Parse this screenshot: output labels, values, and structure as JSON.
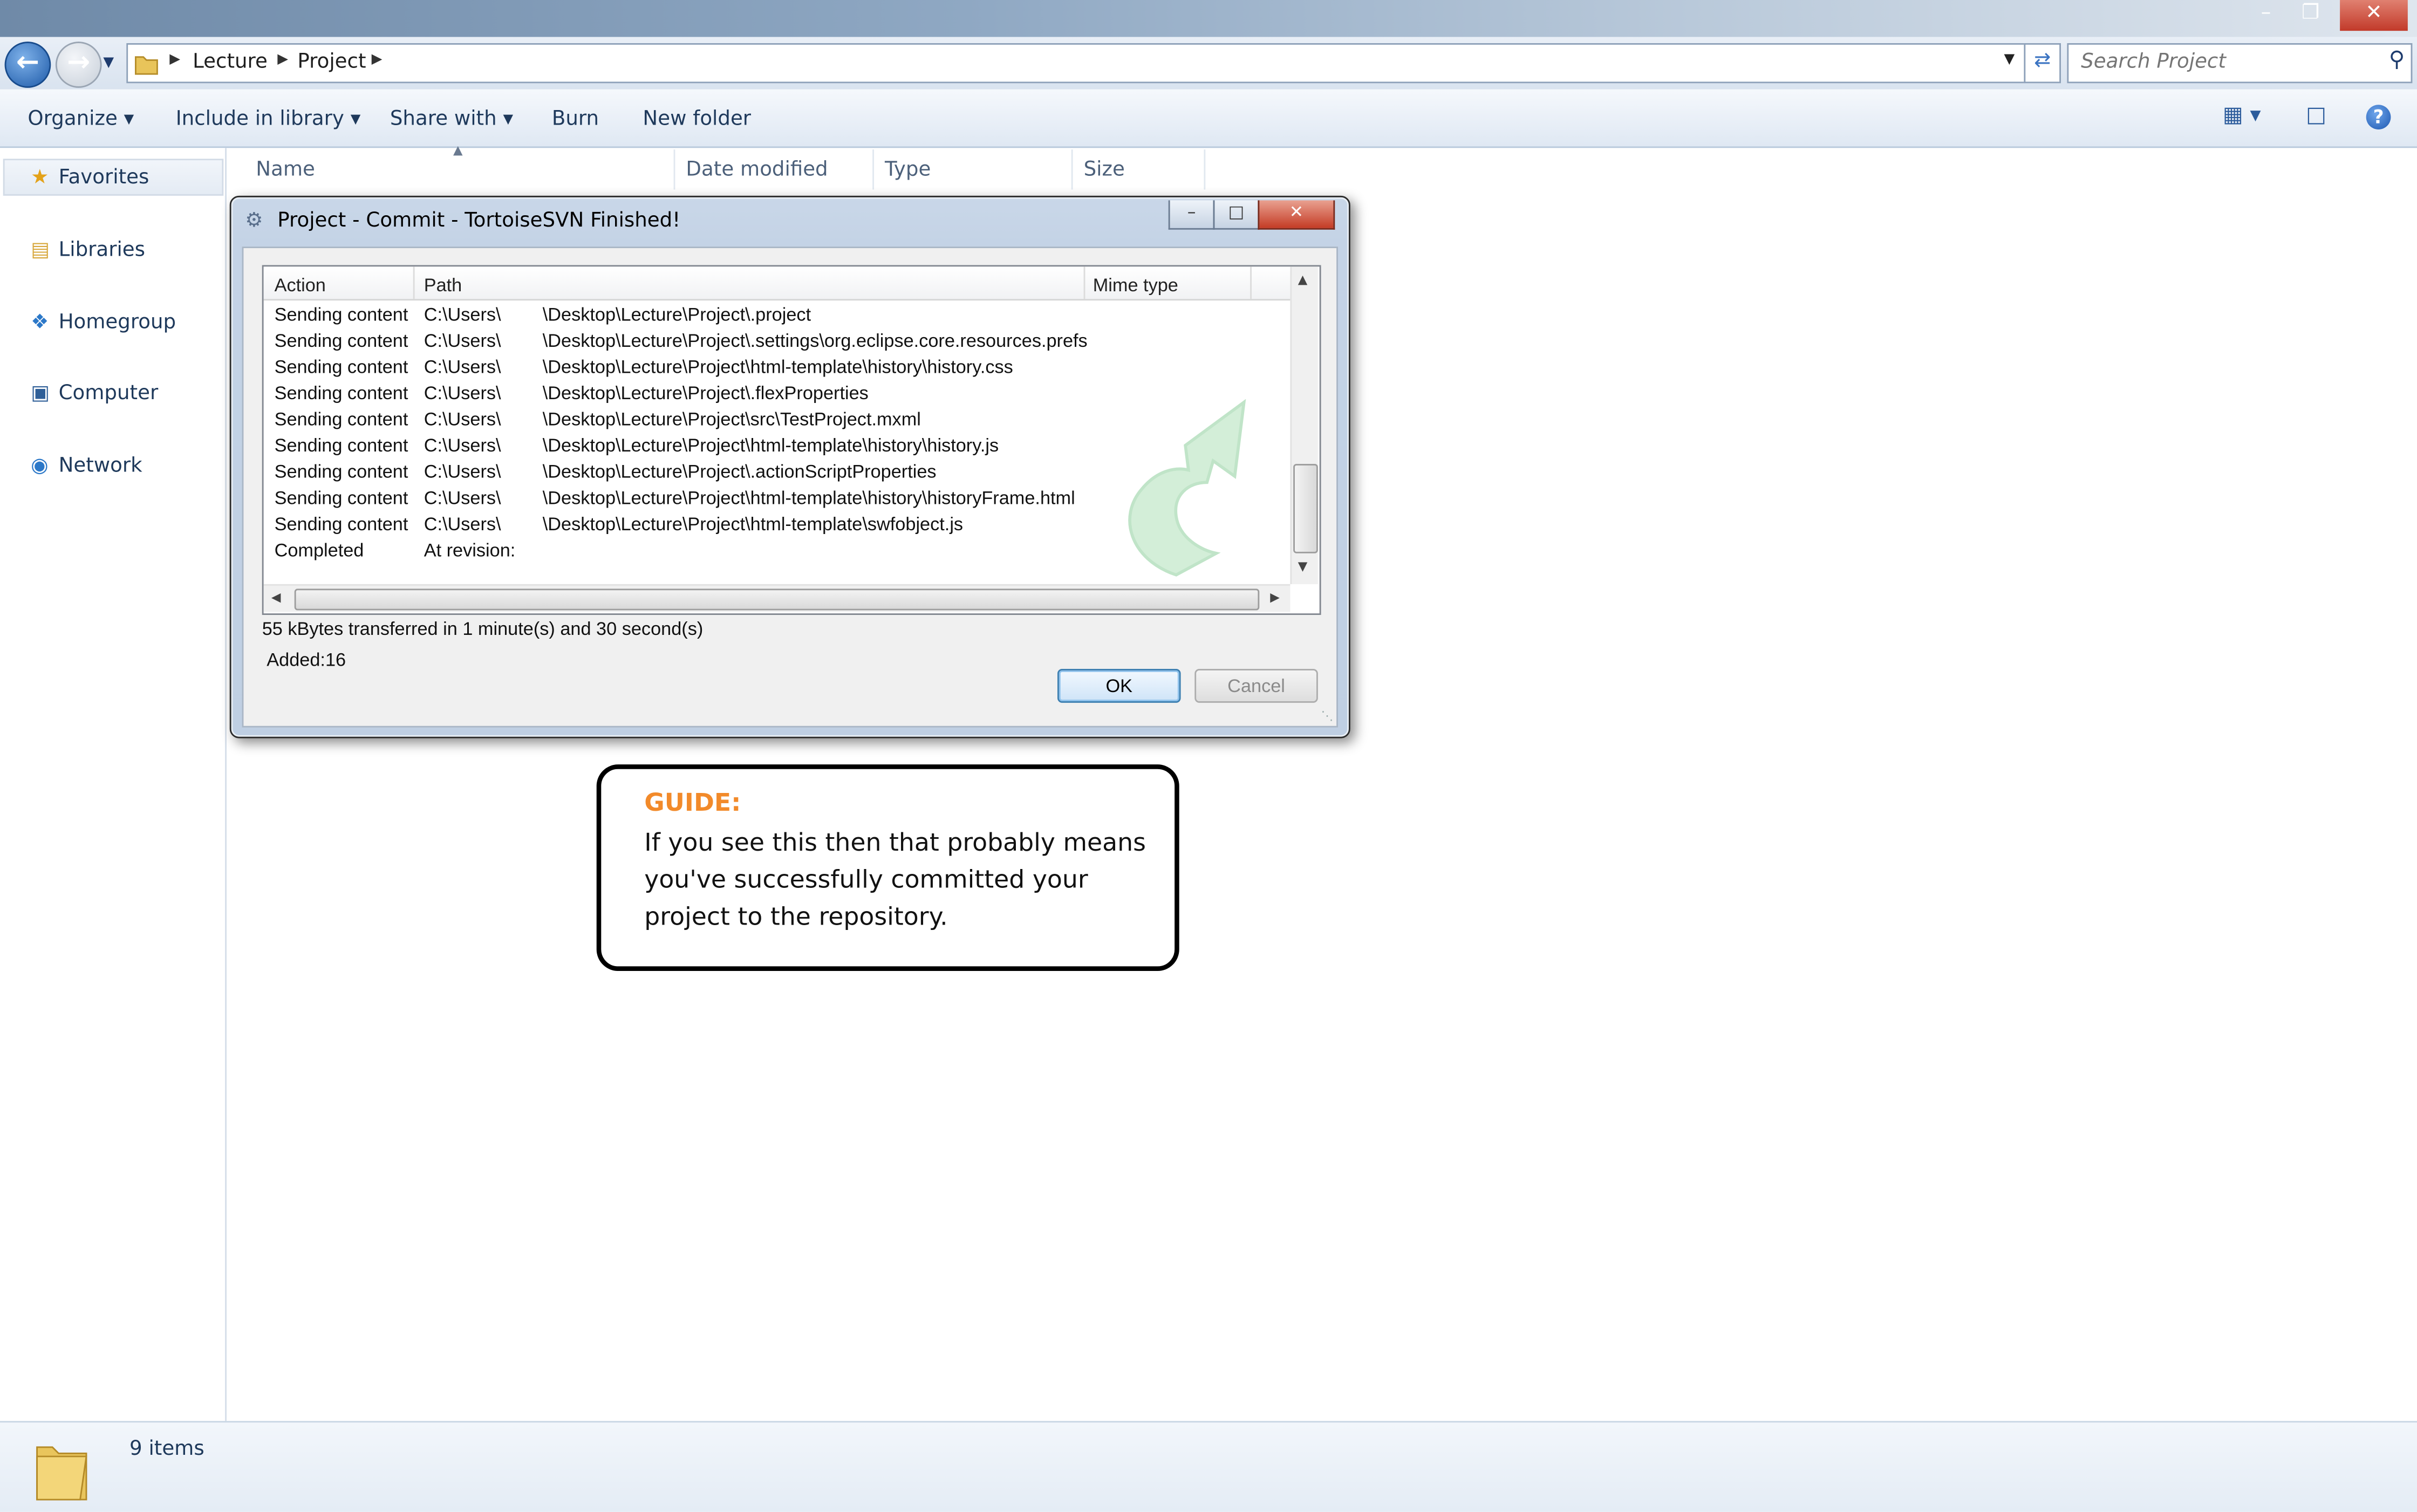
{
  "explorer": {
    "breadcrumb": [
      "Lecture",
      "Project"
    ],
    "search_placeholder": "Search Project",
    "toolbar": {
      "organize": "Organize",
      "include_in_library": "Include in library",
      "share_with": "Share with",
      "burn": "Burn",
      "new_folder": "New folder"
    },
    "nav": {
      "favorites": "Favorites",
      "libraries": "Libraries",
      "homegroup": "Homegroup",
      "computer": "Computer",
      "network": "Network"
    },
    "columns": {
      "name": "Name",
      "date_modified": "Date modified",
      "type": "Type",
      "size": "Size"
    },
    "status": {
      "item_count": "9 items"
    }
  },
  "dialog": {
    "title": "Project - Commit - TortoiseSVN Finished!",
    "columns": {
      "action": "Action",
      "path": "Path",
      "mime_type": "Mime type"
    },
    "rows": [
      {
        "action": "Sending content",
        "path_prefix": "C:\\Users\\",
        "path_suffix": "\\Desktop\\Lecture\\Project\\.project"
      },
      {
        "action": "Sending content",
        "path_prefix": "C:\\Users\\",
        "path_suffix": "\\Desktop\\Lecture\\Project\\.settings\\org.eclipse.core.resources.prefs"
      },
      {
        "action": "Sending content",
        "path_prefix": "C:\\Users\\",
        "path_suffix": "\\Desktop\\Lecture\\Project\\html-template\\history\\history.css"
      },
      {
        "action": "Sending content",
        "path_prefix": "C:\\Users\\",
        "path_suffix": "\\Desktop\\Lecture\\Project\\.flexProperties"
      },
      {
        "action": "Sending content",
        "path_prefix": "C:\\Users\\",
        "path_suffix": "\\Desktop\\Lecture\\Project\\src\\TestProject.mxml"
      },
      {
        "action": "Sending content",
        "path_prefix": "C:\\Users\\",
        "path_suffix": "\\Desktop\\Lecture\\Project\\html-template\\history\\history.js"
      },
      {
        "action": "Sending content",
        "path_prefix": "C:\\Users\\",
        "path_suffix": "\\Desktop\\Lecture\\Project\\.actionScriptProperties"
      },
      {
        "action": "Sending content",
        "path_prefix": "C:\\Users\\",
        "path_suffix": "\\Desktop\\Lecture\\Project\\html-template\\history\\historyFrame.html"
      },
      {
        "action": "Sending content",
        "path_prefix": "C:\\Users\\",
        "path_suffix": "\\Desktop\\Lecture\\Project\\html-template\\swfobject.js"
      },
      {
        "action": "Completed",
        "path_prefix": "At revision:",
        "path_suffix": ""
      }
    ],
    "transfer_info": "55 kBytes transferred in 1 minute(s) and 30 second(s)",
    "added_info": "Added:16",
    "ok_label": "OK",
    "cancel_label": "Cancel"
  },
  "guide": {
    "heading": "GUIDE:",
    "text": "If you see this then that probably means you've successfully committed your project to the repository."
  },
  "colors": {
    "accent": "#f28a2a",
    "link_blue": "#1e395b"
  },
  "icons": [
    "back-arrow-icon",
    "forward-arrow-icon",
    "folder-icon",
    "refresh-icon",
    "search-icon",
    "star-icon",
    "libraries-icon",
    "homegroup-icon",
    "computer-icon",
    "network-icon",
    "view-icon",
    "preview-pane-icon",
    "help-icon",
    "tortoisesvn-icon",
    "commit-arrow-icon"
  ]
}
